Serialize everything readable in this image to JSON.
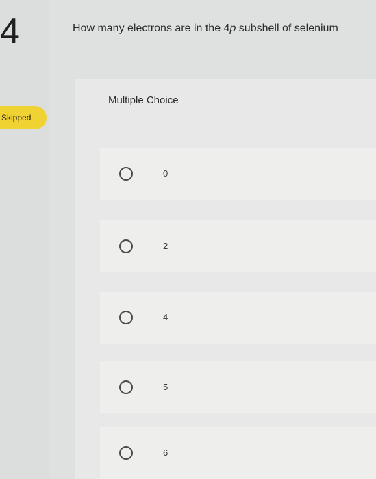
{
  "question": {
    "number": "4",
    "status": "Skipped",
    "text_before": "How many electrons are in the 4",
    "text_italic": "p",
    "text_after": " subshell of selenium"
  },
  "answer_section": {
    "type_label": "Multiple Choice",
    "options": [
      {
        "label": "0"
      },
      {
        "label": "2"
      },
      {
        "label": "4"
      },
      {
        "label": "5"
      },
      {
        "label": "6"
      }
    ]
  },
  "colors": {
    "badge": "#f1d233",
    "background": "#dfe1e0"
  }
}
